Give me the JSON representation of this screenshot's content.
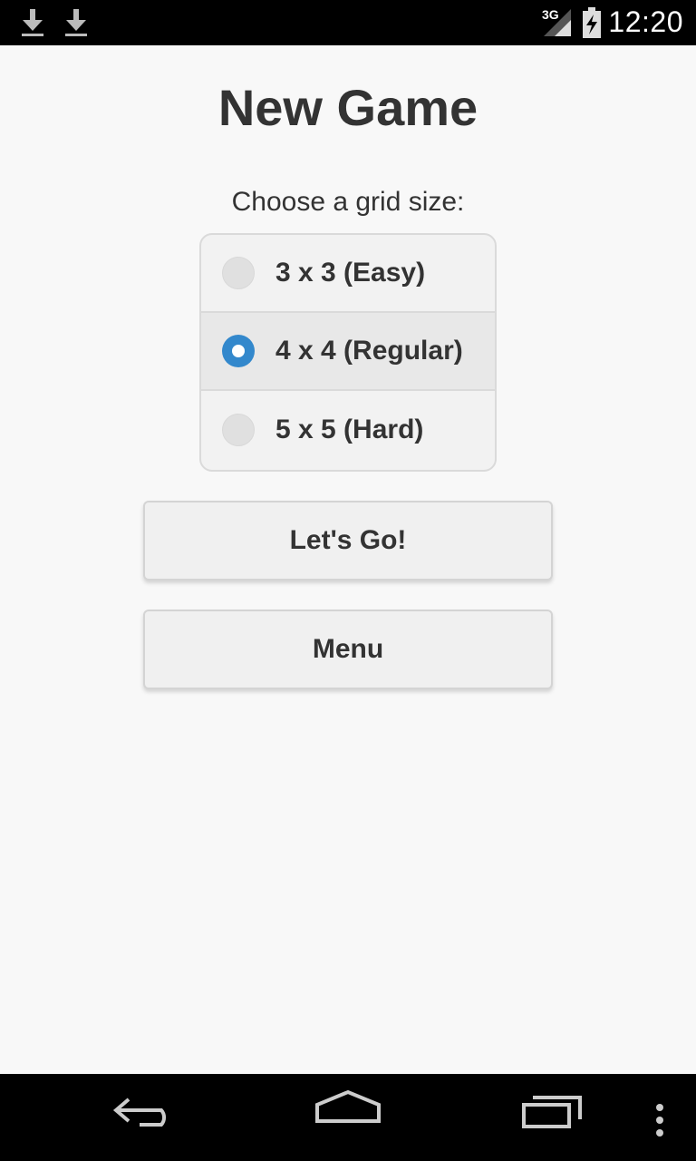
{
  "status_bar": {
    "network": "3G",
    "time": "12:20",
    "icons": [
      "download-icon",
      "download-icon",
      "signal-icon",
      "battery-icon"
    ]
  },
  "screen": {
    "title": "New Game",
    "prompt": "Choose a grid size:",
    "grid_options": [
      {
        "label": "3 x 3 (Easy)",
        "selected": false
      },
      {
        "label": "4 x 4 (Regular)",
        "selected": true
      },
      {
        "label": "5 x 5 (Hard)",
        "selected": false
      }
    ],
    "go_button": "Let's Go!",
    "menu_button": "Menu"
  },
  "nav_bar": {
    "icons": [
      "back-icon",
      "home-icon",
      "recent-apps-icon",
      "overflow-menu-icon"
    ]
  },
  "colors": {
    "accent": "#3388cc",
    "background": "#f8f8f8"
  }
}
